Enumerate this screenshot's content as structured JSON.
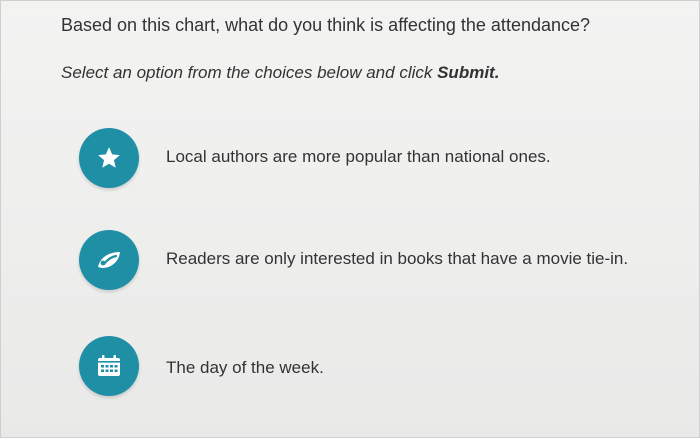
{
  "question": {
    "prompt": "Based on this chart, what do you think is affecting the attendance?",
    "instruction_prefix": "Select an option from the choices below and click ",
    "instruction_action": "Submit."
  },
  "choices": [
    {
      "label": "Local authors are more popular than national ones.",
      "icon": "star-icon"
    },
    {
      "label": "Readers are only interested in books that have a movie tie-in.",
      "icon": "film-reel-icon"
    },
    {
      "label": "The day of the week.",
      "icon": "calendar-icon"
    }
  ],
  "colors": {
    "accent": "#1f8fa6",
    "text": "#333333",
    "background": "#efefee"
  }
}
